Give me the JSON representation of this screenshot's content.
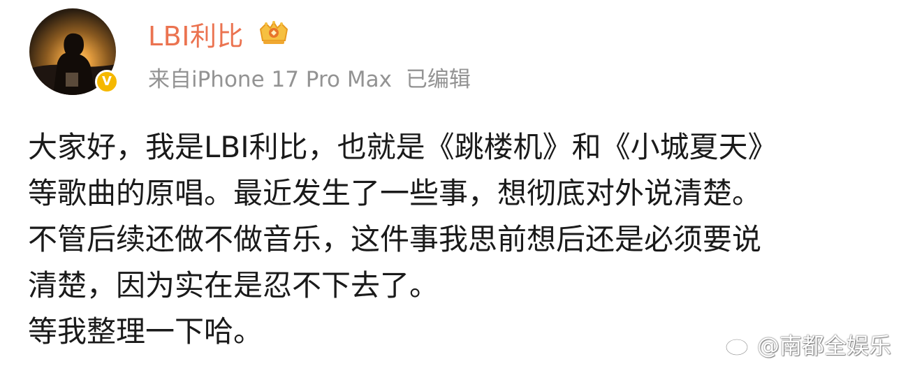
{
  "post": {
    "author": {
      "name": "LBI利比",
      "avatar_icon": "avatar-sunset-silhouette",
      "verified_icon": "verified-v-badge",
      "verified_mark": "V",
      "badge_icon": "crown-badge-icon"
    },
    "meta": {
      "source": "来自iPhone 17 Pro Max",
      "edited": "已编辑"
    },
    "lines": [
      "大家好，我是LBI利比，也就是《跳楼机》和《小城夏天》",
      "等歌曲的原唱。最近发生了一些事，想彻底对外说清楚。",
      "不管后续还做不做音乐，这件事我思前想后还是必须要说",
      "清楚，因为实在是忍不下去了。",
      "等我整理一下哈。"
    ]
  },
  "watermark": {
    "icon": "weibo-logo-icon",
    "text": "@南都全娱乐"
  },
  "colors": {
    "username": "#eb7350",
    "meta": "#939393",
    "body_text": "#1a1a1a",
    "verified": "#f5b800"
  }
}
